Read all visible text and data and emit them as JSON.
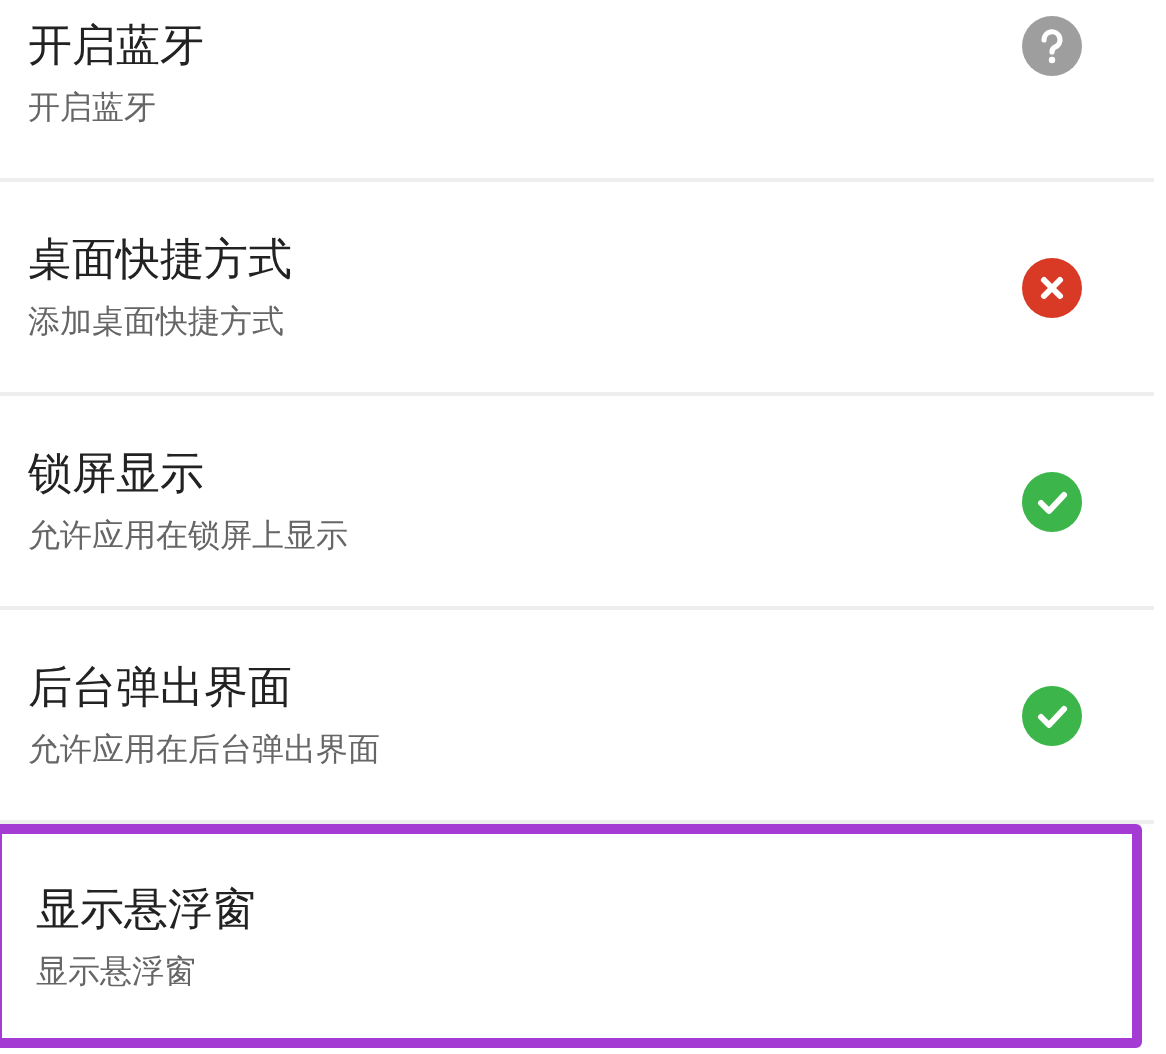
{
  "permissions": [
    {
      "title": "开启蓝牙",
      "subtitle": "开启蓝牙",
      "kind": "unknown",
      "highlighted": false
    },
    {
      "title": "桌面快捷方式",
      "subtitle": "添加桌面快捷方式",
      "kind": "denied",
      "highlighted": false
    },
    {
      "title": "锁屏显示",
      "subtitle": "允许应用在锁屏上显示",
      "kind": "allowed",
      "highlighted": false
    },
    {
      "title": "后台弹出界面",
      "subtitle": "允许应用在后台弹出界面",
      "kind": "allowed",
      "highlighted": false
    },
    {
      "title": "显示悬浮窗",
      "subtitle": "显示悬浮窗",
      "highlighted": true
    }
  ]
}
